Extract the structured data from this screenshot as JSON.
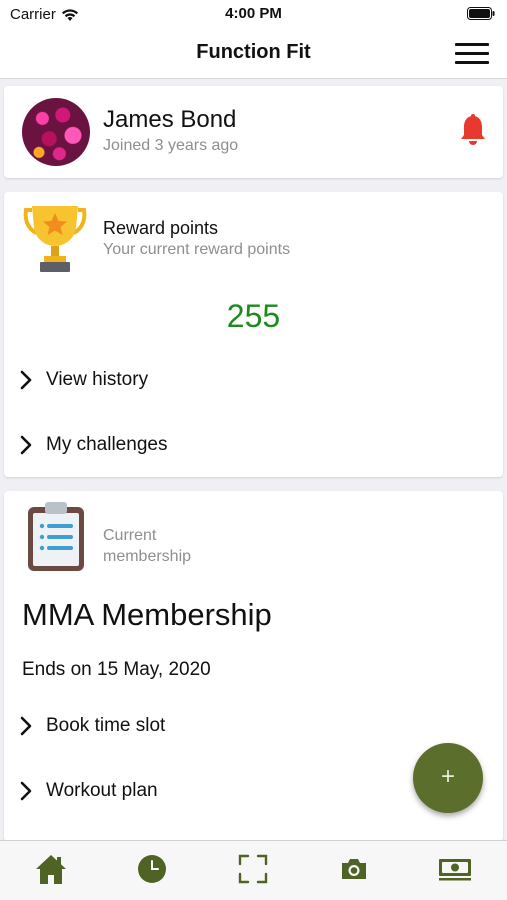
{
  "status_bar": {
    "carrier": "Carrier",
    "time": "4:00 PM",
    "icons": [
      "wifi-icon",
      "battery-icon"
    ]
  },
  "nav": {
    "title": "Function Fit",
    "menu_icon": "hamburger-menu-icon"
  },
  "profile": {
    "name": "James Bond",
    "joined": "Joined 3 years ago",
    "notification_icon": "bell-icon"
  },
  "reward": {
    "title": "Reward points",
    "subtitle": "Your current reward points",
    "points": "255",
    "points_color": "#1e8a1e",
    "links": [
      {
        "label": "View history"
      },
      {
        "label": "My challenges"
      }
    ]
  },
  "membership": {
    "label": "Current membership",
    "name": "MMA Membership",
    "ends": "Ends on 15 May, 2020",
    "links": [
      {
        "label": "Book time slot"
      },
      {
        "label": "Workout plan"
      }
    ]
  },
  "fab": {
    "label": "+",
    "color": "#5b6e2c"
  },
  "tab_bar": {
    "accent": "#4f6424",
    "tabs": [
      {
        "icon": "home-icon"
      },
      {
        "icon": "clock-icon"
      },
      {
        "icon": "scan-icon"
      },
      {
        "icon": "camera-icon"
      },
      {
        "icon": "cash-icon"
      }
    ]
  },
  "colors": {
    "bell": "#e8392e",
    "background": "#efeff4"
  }
}
